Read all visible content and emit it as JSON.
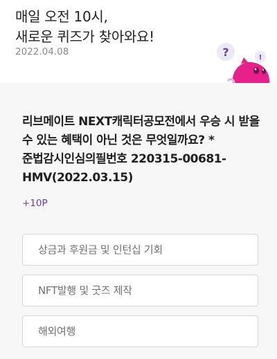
{
  "header": {
    "title_line1": "매일 오전 10시,",
    "title_line2": "새로운 퀴즈가 찾아와요!",
    "date": "2022.04.08"
  },
  "mascot": {
    "question_mark": "?",
    "exclamation_mark": "!",
    "icon": "quiz-mascot-icon",
    "body_color": "#e8208a"
  },
  "quiz": {
    "question": "리브메이트 NEXT캐릭터공모전에서 우승 시 받을 수 있는 혜택이 아닌 것은 무엇일까요? *준법감시인심의필번호 220315-00681-HMV(2022.03.15)",
    "points": "+10P",
    "options": [
      "상금과 후원금 및 인턴십 기회",
      "NFT발행 및 굿즈 제작",
      "해외여행"
    ]
  },
  "colors": {
    "accent": "#6b3fa0",
    "panel_background": "#f7f7f7"
  }
}
